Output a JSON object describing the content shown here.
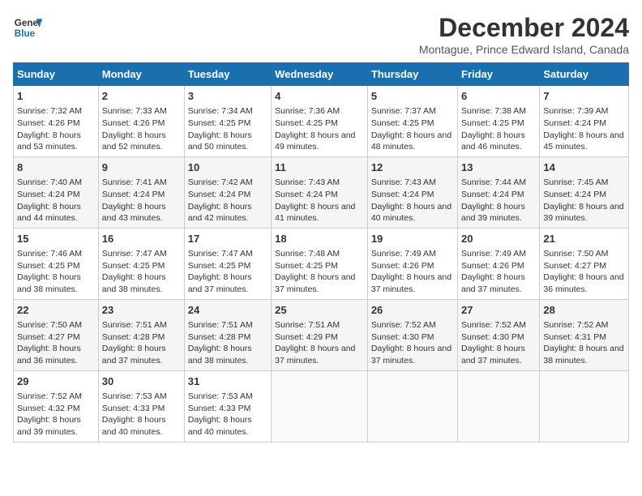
{
  "logo": {
    "line1": "General",
    "line2": "Blue"
  },
  "title": "December 2024",
  "subtitle": "Montague, Prince Edward Island, Canada",
  "days_of_week": [
    "Sunday",
    "Monday",
    "Tuesday",
    "Wednesday",
    "Thursday",
    "Friday",
    "Saturday"
  ],
  "weeks": [
    [
      {
        "day": "1",
        "sunrise": "Sunrise: 7:32 AM",
        "sunset": "Sunset: 4:26 PM",
        "daylight": "Daylight: 8 hours and 53 minutes."
      },
      {
        "day": "2",
        "sunrise": "Sunrise: 7:33 AM",
        "sunset": "Sunset: 4:26 PM",
        "daylight": "Daylight: 8 hours and 52 minutes."
      },
      {
        "day": "3",
        "sunrise": "Sunrise: 7:34 AM",
        "sunset": "Sunset: 4:25 PM",
        "daylight": "Daylight: 8 hours and 50 minutes."
      },
      {
        "day": "4",
        "sunrise": "Sunrise: 7:36 AM",
        "sunset": "Sunset: 4:25 PM",
        "daylight": "Daylight: 8 hours and 49 minutes."
      },
      {
        "day": "5",
        "sunrise": "Sunrise: 7:37 AM",
        "sunset": "Sunset: 4:25 PM",
        "daylight": "Daylight: 8 hours and 48 minutes."
      },
      {
        "day": "6",
        "sunrise": "Sunrise: 7:38 AM",
        "sunset": "Sunset: 4:25 PM",
        "daylight": "Daylight: 8 hours and 46 minutes."
      },
      {
        "day": "7",
        "sunrise": "Sunrise: 7:39 AM",
        "sunset": "Sunset: 4:24 PM",
        "daylight": "Daylight: 8 hours and 45 minutes."
      }
    ],
    [
      {
        "day": "8",
        "sunrise": "Sunrise: 7:40 AM",
        "sunset": "Sunset: 4:24 PM",
        "daylight": "Daylight: 8 hours and 44 minutes."
      },
      {
        "day": "9",
        "sunrise": "Sunrise: 7:41 AM",
        "sunset": "Sunset: 4:24 PM",
        "daylight": "Daylight: 8 hours and 43 minutes."
      },
      {
        "day": "10",
        "sunrise": "Sunrise: 7:42 AM",
        "sunset": "Sunset: 4:24 PM",
        "daylight": "Daylight: 8 hours and 42 minutes."
      },
      {
        "day": "11",
        "sunrise": "Sunrise: 7:43 AM",
        "sunset": "Sunset: 4:24 PM",
        "daylight": "Daylight: 8 hours and 41 minutes."
      },
      {
        "day": "12",
        "sunrise": "Sunrise: 7:43 AM",
        "sunset": "Sunset: 4:24 PM",
        "daylight": "Daylight: 8 hours and 40 minutes."
      },
      {
        "day": "13",
        "sunrise": "Sunrise: 7:44 AM",
        "sunset": "Sunset: 4:24 PM",
        "daylight": "Daylight: 8 hours and 39 minutes."
      },
      {
        "day": "14",
        "sunrise": "Sunrise: 7:45 AM",
        "sunset": "Sunset: 4:24 PM",
        "daylight": "Daylight: 8 hours and 39 minutes."
      }
    ],
    [
      {
        "day": "15",
        "sunrise": "Sunrise: 7:46 AM",
        "sunset": "Sunset: 4:25 PM",
        "daylight": "Daylight: 8 hours and 38 minutes."
      },
      {
        "day": "16",
        "sunrise": "Sunrise: 7:47 AM",
        "sunset": "Sunset: 4:25 PM",
        "daylight": "Daylight: 8 hours and 38 minutes."
      },
      {
        "day": "17",
        "sunrise": "Sunrise: 7:47 AM",
        "sunset": "Sunset: 4:25 PM",
        "daylight": "Daylight: 8 hours and 37 minutes."
      },
      {
        "day": "18",
        "sunrise": "Sunrise: 7:48 AM",
        "sunset": "Sunset: 4:25 PM",
        "daylight": "Daylight: 8 hours and 37 minutes."
      },
      {
        "day": "19",
        "sunrise": "Sunrise: 7:49 AM",
        "sunset": "Sunset: 4:26 PM",
        "daylight": "Daylight: 8 hours and 37 minutes."
      },
      {
        "day": "20",
        "sunrise": "Sunrise: 7:49 AM",
        "sunset": "Sunset: 4:26 PM",
        "daylight": "Daylight: 8 hours and 37 minutes."
      },
      {
        "day": "21",
        "sunrise": "Sunrise: 7:50 AM",
        "sunset": "Sunset: 4:27 PM",
        "daylight": "Daylight: 8 hours and 36 minutes."
      }
    ],
    [
      {
        "day": "22",
        "sunrise": "Sunrise: 7:50 AM",
        "sunset": "Sunset: 4:27 PM",
        "daylight": "Daylight: 8 hours and 36 minutes."
      },
      {
        "day": "23",
        "sunrise": "Sunrise: 7:51 AM",
        "sunset": "Sunset: 4:28 PM",
        "daylight": "Daylight: 8 hours and 37 minutes."
      },
      {
        "day": "24",
        "sunrise": "Sunrise: 7:51 AM",
        "sunset": "Sunset: 4:28 PM",
        "daylight": "Daylight: 8 hours and 38 minutes."
      },
      {
        "day": "25",
        "sunrise": "Sunrise: 7:51 AM",
        "sunset": "Sunset: 4:29 PM",
        "daylight": "Daylight: 8 hours and 37 minutes."
      },
      {
        "day": "26",
        "sunrise": "Sunrise: 7:52 AM",
        "sunset": "Sunset: 4:30 PM",
        "daylight": "Daylight: 8 hours and 37 minutes."
      },
      {
        "day": "27",
        "sunrise": "Sunrise: 7:52 AM",
        "sunset": "Sunset: 4:30 PM",
        "daylight": "Daylight: 8 hours and 37 minutes."
      },
      {
        "day": "28",
        "sunrise": "Sunrise: 7:52 AM",
        "sunset": "Sunset: 4:31 PM",
        "daylight": "Daylight: 8 hours and 38 minutes."
      }
    ],
    [
      {
        "day": "29",
        "sunrise": "Sunrise: 7:52 AM",
        "sunset": "Sunset: 4:32 PM",
        "daylight": "Daylight: 8 hours and 39 minutes."
      },
      {
        "day": "30",
        "sunrise": "Sunrise: 7:53 AM",
        "sunset": "Sunset: 4:33 PM",
        "daylight": "Daylight: 8 hours and 40 minutes."
      },
      {
        "day": "31",
        "sunrise": "Sunrise: 7:53 AM",
        "sunset": "Sunset: 4:33 PM",
        "daylight": "Daylight: 8 hours and 40 minutes."
      },
      null,
      null,
      null,
      null
    ]
  ]
}
